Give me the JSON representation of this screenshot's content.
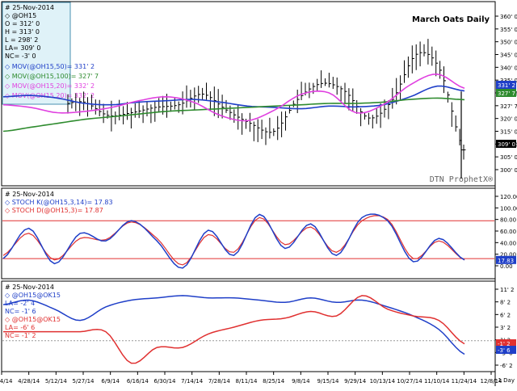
{
  "colors": {
    "background": "#ffffff",
    "price": "#000000",
    "ma50": "#1f3fc8",
    "ma100": "#2e8b2e",
    "ma20": "#e040e0",
    "stoch_k": "#1f3fc8",
    "stoch_d": "#e03030",
    "spread_blue": "#1f3fc8",
    "spread_red": "#e03030",
    "ref_line": "#e03030",
    "info_box_bg": "#dff2f8",
    "info_box_border": "#4a90b0",
    "tag_331": "#1f3fc8",
    "tag_327": "#2e8b2e",
    "tag_332": "#e040e0",
    "tag_309": "#000000",
    "tag_178": "#1f3fc8",
    "tag_neg3": "#1f3fc8",
    "tag_neg1": "#e03030"
  },
  "panel1": {
    "title": "March Oats Daily",
    "watermark": "DTN ProphetX®",
    "info": {
      "date": "# 25-Nov-2014",
      "symbol": "◇ @OH15",
      "open": "O = 312' 0",
      "high": "H = 313' 0",
      "low": "L = 298' 2",
      "last": "LA= 309' 0",
      "net": "NC= -3' 0",
      "ma50": "◇ MOV(@OH15,50)= 331' 2",
      "ma100": "◇ MOV(@OH15,100)= 327' 7",
      "ma20": "◇ MOV(@OH15,20)= 332' 2",
      "ma20b": "◇ MOV(@OH15,20)= 332' 2"
    },
    "y_ticks": [
      "360' 0",
      "355' 0",
      "350' 0",
      "345' 0",
      "340' 0",
      "335' 0",
      "331' 2",
      "327' 7",
      "320' 0",
      "315' 0",
      "309' 0",
      "305' 0",
      "300' 0"
    ],
    "tags": {
      "ma50": "331' 2",
      "ma100": "327' 7",
      "ma20": "332' 2",
      "last": "309' 0"
    }
  },
  "panel2": {
    "info": {
      "date": "# 25-Nov-2014",
      "k": "◇ STOCH K(@OH15,3,14)= 17.83",
      "d": "◇ STOCH D(@OH15,3)= 17.87"
    },
    "y_ticks": [
      "120.00",
      "100.00",
      "80.00",
      "60.00",
      "40.00",
      "20.00",
      "0.00"
    ],
    "tag": "17.83"
  },
  "panel3": {
    "info": {
      "date": "# 25-Nov-2014",
      "spread": "◇ @OH15@OK15",
      "last": "LA= -2' 4",
      "net": "NC= -1' 6",
      "spread2": "◇ @OH15@OK15",
      "last2": "LA= -6' 6",
      "net2": "NC= -1' 2"
    },
    "y_ticks": [
      "11' 2",
      "8' 2",
      "6' 2",
      "3' 2",
      "1' 2",
      "-3' 6",
      "-6' 2"
    ],
    "tags": {
      "blue": "-3' 6",
      "red": "-1' 2"
    }
  },
  "x_axis": {
    "labels": [
      "4/14/14",
      "4/28/14",
      "5/12/14",
      "5/27/14",
      "6/9/14",
      "6/16/14",
      "6/30/14",
      "7/14/14",
      "7/28/14",
      "8/11/14",
      "8/25/14",
      "9/8/14",
      "9/15/14",
      "9/29/14",
      "10/13/14",
      "10/27/14",
      "11/10/14",
      "11/24/14",
      "12/8/14"
    ],
    "unit": "1 Day"
  },
  "chart_data": [
    {
      "type": "line",
      "title": "March Oats Daily",
      "ylim": [
        297,
        363
      ],
      "x": [
        "4/14/14",
        "4/28/14",
        "5/12/14",
        "5/27/14",
        "6/9/14",
        "6/16/14",
        "6/30/14",
        "7/14/14",
        "7/28/14",
        "8/11/14",
        "8/25/14",
        "9/8/14",
        "9/15/14",
        "9/29/14",
        "10/13/14",
        "10/27/14",
        "11/10/14",
        "11/24/14"
      ],
      "price_close": [
        326,
        327,
        322,
        323,
        325,
        326,
        330,
        324,
        319,
        316,
        328,
        334,
        331,
        321,
        328,
        345,
        339,
        309
      ],
      "series": [
        {
          "name": "MOV(@OH15,50)",
          "values": [
            329.0,
            329.5,
            328.5,
            326.5,
            326,
            327,
            327.5,
            328,
            327,
            325.5,
            325,
            324.5,
            325.5,
            325.2,
            326,
            329,
            333,
            331.2
          ]
        },
        {
          "name": "MOV(@OH15,100)",
          "values": [
            316,
            317.5,
            319,
            320.5,
            321.5,
            322.5,
            323.5,
            324.0,
            324.5,
            325,
            325.5,
            326,
            326.5,
            326.5,
            327,
            328,
            328.5,
            327.9
          ]
        },
        {
          "name": "MOV(@OH15,20)",
          "values": [
            326,
            325,
            323,
            323.5,
            325,
            327.5,
            329,
            327,
            322,
            320,
            324,
            330,
            330.5,
            323,
            326,
            333.5,
            337.5,
            332.2
          ]
        }
      ]
    },
    {
      "type": "line",
      "ylim": [
        -8,
        125
      ],
      "series": [
        {
          "name": "STOCH K(@OH15,3,14)",
          "values": [
            20,
            68,
            12,
            60,
            48,
            80,
            48,
            5,
            65,
            25,
            90,
            36,
            75,
            25,
            85,
            80,
            15,
            52,
            17.83
          ]
        },
        {
          "name": "STOCH D(@OH15,3)",
          "values": [
            25,
            60,
            18,
            52,
            50,
            78,
            52,
            10,
            58,
            30,
            85,
            42,
            70,
            30,
            80,
            82,
            20,
            48,
            17.87
          ]
        }
      ],
      "hlines": [
        80,
        20
      ]
    },
    {
      "type": "line",
      "ylim": [
        -7,
        12
      ],
      "series": [
        {
          "name": "@OH15@OK15",
          "values": [
            7.5,
            8.5,
            6.5,
            4,
            7,
            8.5,
            9,
            9.5,
            9,
            9,
            8.5,
            8,
            9,
            8,
            8.5,
            7,
            5,
            2,
            -3.5
          ]
        },
        {
          "name": "@OH15@OK15",
          "values": [
            1.5,
            1.5,
            1.5,
            1.5,
            1.5,
            -5.5,
            -2,
            -2,
            1,
            2.5,
            4,
            4.5,
            6,
            5,
            9.5,
            6.5,
            5,
            4,
            -1.2
          ]
        }
      ],
      "hlines": [
        -0.5
      ]
    }
  ]
}
